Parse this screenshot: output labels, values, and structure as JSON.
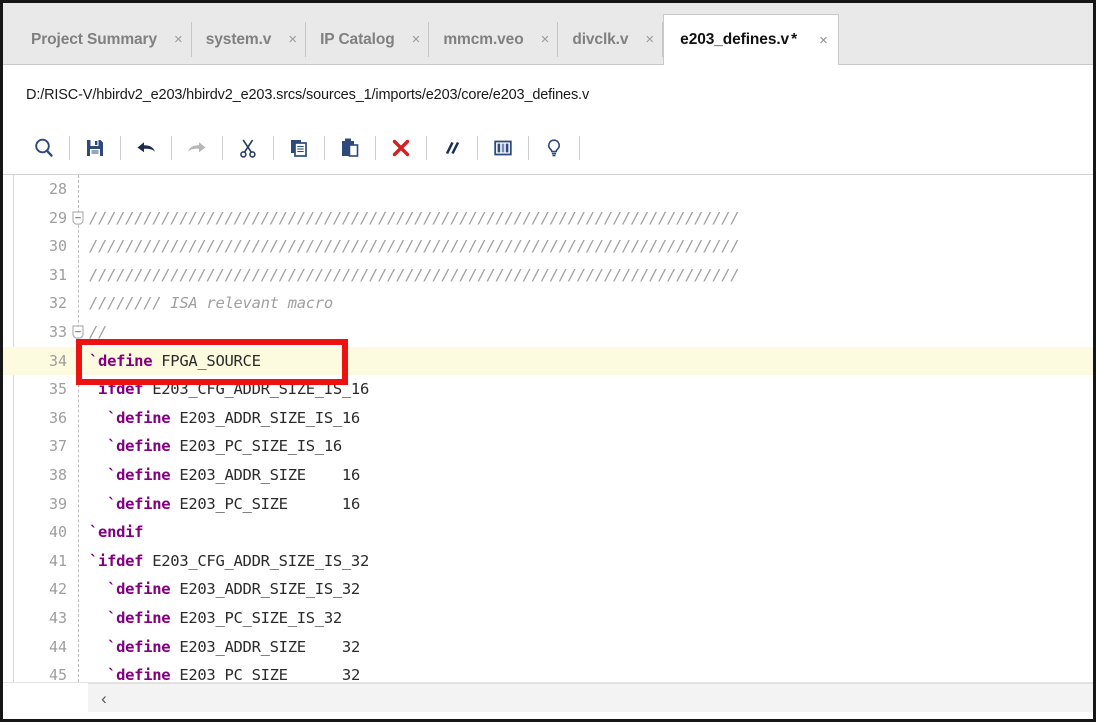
{
  "window": {
    "app": "Vivado Text Editor"
  },
  "tabs": [
    {
      "label": "Project Summary",
      "close": "×",
      "active": false,
      "dirty": ""
    },
    {
      "label": "system.v",
      "close": "×",
      "active": false,
      "dirty": ""
    },
    {
      "label": "IP Catalog",
      "close": "×",
      "active": false,
      "dirty": ""
    },
    {
      "label": "mmcm.veo",
      "close": "×",
      "active": false,
      "dirty": ""
    },
    {
      "label": "divclk.v",
      "close": "×",
      "active": false,
      "dirty": ""
    },
    {
      "label": "e203_defines.v",
      "close": "×",
      "active": true,
      "dirty": "*"
    }
  ],
  "path_bar": {
    "path": "D:/RISC-V/hbirdv2_e203/hbirdv2_e203.srcs/sources_1/imports/e203/core/e203_defines.v"
  },
  "toolbar": {
    "buttons": [
      {
        "name": "find-icon",
        "title": "Find",
        "enabled": true
      },
      {
        "name": "save-icon",
        "title": "Save File",
        "enabled": true
      },
      {
        "name": "undo-icon",
        "title": "Undo",
        "enabled": true
      },
      {
        "name": "redo-icon",
        "title": "Redo",
        "enabled": false
      },
      {
        "name": "cut-icon",
        "title": "Cut",
        "enabled": true
      },
      {
        "name": "copy-icon",
        "title": "Copy",
        "enabled": true
      },
      {
        "name": "paste-icon",
        "title": "Paste",
        "enabled": true
      },
      {
        "name": "delete-icon",
        "title": "Delete",
        "enabled": true
      },
      {
        "name": "comment-icon",
        "title": "Toggle Comment",
        "enabled": true
      },
      {
        "name": "column-edit-icon",
        "title": "Column Edit",
        "enabled": true
      },
      {
        "name": "hint-icon",
        "title": "Show Hints",
        "enabled": true
      }
    ]
  },
  "editor": {
    "current_line": 34,
    "lines": [
      {
        "no": "28",
        "fold": "none",
        "tokens": []
      },
      {
        "no": "29",
        "fold": "minus",
        "tokens": [
          {
            "t": "comment",
            "s": "////////////////////////////////////////////////////////////////////////"
          }
        ]
      },
      {
        "no": "30",
        "fold": "none",
        "tokens": [
          {
            "t": "comment",
            "s": "////////////////////////////////////////////////////////////////////////"
          }
        ]
      },
      {
        "no": "31",
        "fold": "none",
        "tokens": [
          {
            "t": "comment",
            "s": "////////////////////////////////////////////////////////////////////////"
          }
        ]
      },
      {
        "no": "32",
        "fold": "none",
        "tokens": [
          {
            "t": "comment",
            "s": "//////// ISA relevant macro"
          }
        ]
      },
      {
        "no": "33",
        "fold": "minus",
        "tokens": [
          {
            "t": "comment",
            "s": "//"
          }
        ]
      },
      {
        "no": "34",
        "fold": "none",
        "tokens": [
          {
            "t": "kw",
            "s": "`define"
          },
          {
            "t": "id",
            "s": " FPGA_SOURCE"
          }
        ]
      },
      {
        "no": "35",
        "fold": "none",
        "tokens": [
          {
            "t": "kw",
            "s": "`ifdef"
          },
          {
            "t": "id",
            "s": " E203_CFG_ADDR_SIZE_IS_16"
          }
        ]
      },
      {
        "no": "36",
        "fold": "none",
        "tokens": [
          {
            "t": "kw",
            "s": "  `define"
          },
          {
            "t": "id",
            "s": " E203_ADDR_SIZE_IS_16"
          }
        ]
      },
      {
        "no": "37",
        "fold": "none",
        "tokens": [
          {
            "t": "kw",
            "s": "  `define"
          },
          {
            "t": "id",
            "s": " E203_PC_SIZE_IS_16"
          }
        ]
      },
      {
        "no": "38",
        "fold": "none",
        "tokens": [
          {
            "t": "kw",
            "s": "  `define"
          },
          {
            "t": "id",
            "s": " E203_ADDR_SIZE"
          },
          {
            "t": "num",
            "s": "    16"
          }
        ]
      },
      {
        "no": "39",
        "fold": "none",
        "tokens": [
          {
            "t": "kw",
            "s": "  `define"
          },
          {
            "t": "id",
            "s": " E203_PC_SIZE"
          },
          {
            "t": "num",
            "s": "      16"
          }
        ]
      },
      {
        "no": "40",
        "fold": "none",
        "tokens": [
          {
            "t": "kw",
            "s": "`endif"
          }
        ]
      },
      {
        "no": "41",
        "fold": "none",
        "tokens": [
          {
            "t": "kw",
            "s": "`ifdef"
          },
          {
            "t": "id",
            "s": " E203_CFG_ADDR_SIZE_IS_32"
          }
        ]
      },
      {
        "no": "42",
        "fold": "none",
        "tokens": [
          {
            "t": "kw",
            "s": "  `define"
          },
          {
            "t": "id",
            "s": " E203_ADDR_SIZE_IS_32"
          }
        ]
      },
      {
        "no": "43",
        "fold": "none",
        "tokens": [
          {
            "t": "kw",
            "s": "  `define"
          },
          {
            "t": "id",
            "s": " E203_PC_SIZE_IS_32"
          }
        ]
      },
      {
        "no": "44",
        "fold": "none",
        "tokens": [
          {
            "t": "kw",
            "s": "  `define"
          },
          {
            "t": "id",
            "s": " E203_ADDR_SIZE"
          },
          {
            "t": "num",
            "s": "    32"
          }
        ]
      },
      {
        "no": "45",
        "fold": "none",
        "tokens": [
          {
            "t": "kw",
            "s": "  `define"
          },
          {
            "t": "id",
            "s": " E203_PC_SIZE"
          },
          {
            "t": "num",
            "s": "      32"
          }
        ]
      }
    ]
  },
  "annotation": {
    "type": "red-rectangle",
    "color": "#ee1111",
    "targets_line": "34",
    "targets_text": "`define FPGA_SOURCE"
  },
  "scrollbar": {
    "left_arrow": "‹"
  },
  "colors": {
    "keyword": "#800080",
    "comment": "#a0a0a0",
    "identifier": "#2b2b2b",
    "current_line_highlight": "#fcfbdf",
    "annotation_red": "#ee1111",
    "tab_inactive_text": "#808080",
    "tab_active_text": "#121212",
    "toolbar_icon": "#2e4a7d",
    "delete_icon": "#d42020"
  }
}
